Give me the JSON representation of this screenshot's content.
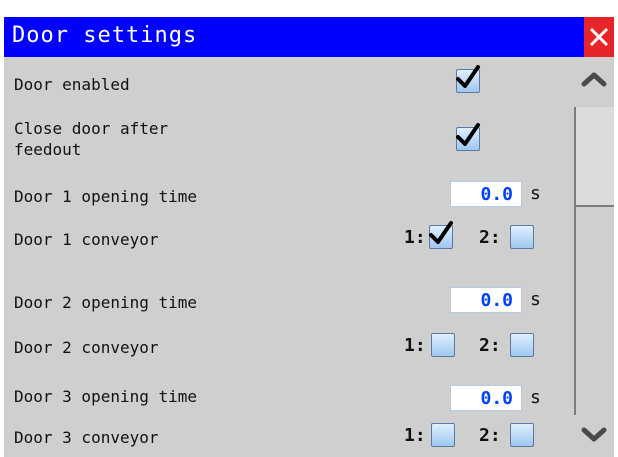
{
  "window": {
    "title": "Door settings"
  },
  "settings": {
    "door_enabled": {
      "label": "Door enabled",
      "checked": true
    },
    "close_after_feedout": {
      "label1": "Close door after",
      "label2": "feedout",
      "checked": true
    },
    "door1_opening_time": {
      "label": "Door 1 opening time",
      "value": "0.0",
      "unit": "s"
    },
    "door1_conveyor": {
      "label": "Door 1 conveyor",
      "c1_label": "1:",
      "c1_checked": true,
      "c2_label": "2:",
      "c2_checked": false
    },
    "door2_opening_time": {
      "label": "Door 2 opening time",
      "value": "0.0",
      "unit": "s"
    },
    "door2_conveyor": {
      "label": "Door 2 conveyor",
      "c1_label": "1:",
      "c1_checked": false,
      "c2_label": "2:",
      "c2_checked": false
    },
    "door3_opening_time": {
      "label": "Door 3 opening time",
      "value": "0.0",
      "unit": "s"
    },
    "door3_conveyor": {
      "label": "Door 3 conveyor",
      "c1_label": "1:",
      "c1_checked": false,
      "c2_label": "2:",
      "c2_checked": false
    }
  },
  "colors": {
    "titlebar": "#0000ff",
    "close": "#e6252b",
    "value_text": "#0040ff",
    "background": "#cfcfcf"
  }
}
